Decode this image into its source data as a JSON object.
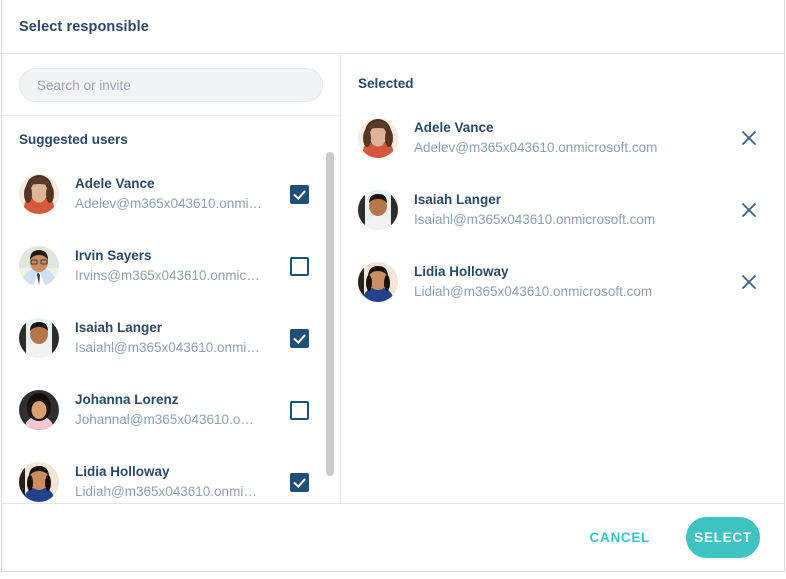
{
  "dialog": {
    "title": "Select responsible"
  },
  "search": {
    "placeholder": "Search or invite",
    "value": ""
  },
  "left": {
    "heading": "Suggested users",
    "users": [
      {
        "name": "Adele Vance",
        "email": "Adelev@m365x043610.onmi…",
        "checked": true,
        "avatar": "woman-brown-hair"
      },
      {
        "name": "Irvin Sayers",
        "email": "Irvins@m365x043610.onmic…",
        "checked": false,
        "avatar": "man-glasses-tie"
      },
      {
        "name": "Isaiah Langer",
        "email": "Isaiahl@m365x043610.onmi…",
        "checked": true,
        "avatar": "man-white-shirt"
      },
      {
        "name": "Johanna Lorenz",
        "email": "Johannal@m365x043610.o…",
        "checked": false,
        "avatar": "woman-dark-hair"
      },
      {
        "name": "Lidia Holloway",
        "email": "Lidiah@m365x043610.onmi…",
        "checked": true,
        "avatar": "woman-blue-top"
      }
    ]
  },
  "right": {
    "heading": "Selected",
    "users": [
      {
        "name": "Adele Vance",
        "email": "Adelev@m365x043610.onmicrosoft.com",
        "avatar": "woman-brown-hair",
        "remove_icon": "close-icon"
      },
      {
        "name": "Isaiah Langer",
        "email": "Isaiahl@m365x043610.onmicrosoft.com",
        "avatar": "man-white-shirt",
        "remove_icon": "close-icon"
      },
      {
        "name": "Lidia Holloway",
        "email": "Lidiah@m365x043610.onmicrosoft.com",
        "avatar": "woman-blue-top",
        "remove_icon": "close-icon"
      }
    ]
  },
  "footer": {
    "cancel_label": "CANCEL",
    "select_label": "SELECT"
  },
  "colors": {
    "accent_teal": "#3ec2c2",
    "navy_text": "#2b4865",
    "checkbox_navy": "#1f4e79",
    "muted_text": "#8fa0b3",
    "border": "#e4e6e9",
    "search_bg": "#f2f3f4",
    "scrollbar": "#c8cacc"
  }
}
